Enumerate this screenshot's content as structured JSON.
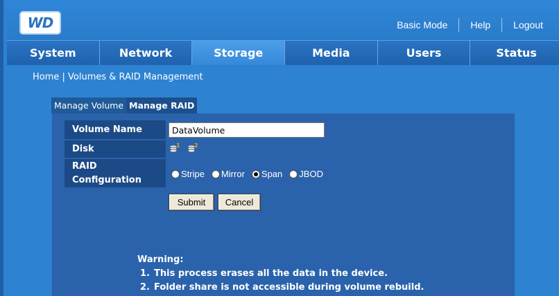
{
  "logo": {
    "text": "WD"
  },
  "top_links": [
    "Basic Mode",
    "Help",
    "Logout"
  ],
  "nav": {
    "tabs": [
      "System",
      "Network",
      "Storage",
      "Media",
      "Users",
      "Status"
    ],
    "active": "Storage"
  },
  "breadcrumb": "Home | Volumes & RAID Management",
  "subtabs": {
    "manage_volume": "Manage Volume",
    "manage_raid": "Manage RAID"
  },
  "form": {
    "volume_name_label": "Volume Name",
    "volume_name_value": "DataVolume",
    "disk_label": "Disk",
    "disks": [
      "1",
      "2"
    ],
    "raid_label_line1": "RAID",
    "raid_label_line2": "Configuration",
    "raid_options": [
      "Stripe",
      "Mirror",
      "Span",
      "JBOD"
    ],
    "raid_selected": "Span",
    "submit": "Submit",
    "cancel": "Cancel"
  },
  "warning": {
    "title": "Warning:",
    "items": [
      {
        "num": "1.",
        "text": "This process erases all the data in the device."
      },
      {
        "num": "2.",
        "text": "Folder share is not accessible during volume rebuild."
      }
    ]
  },
  "colors": {
    "page_bg": "#2d82d2",
    "nav_active": "#3689d9",
    "panel_bg": "#2a63ab",
    "label_bg": "#1c4a86",
    "disk_badge": "#f0a020"
  }
}
